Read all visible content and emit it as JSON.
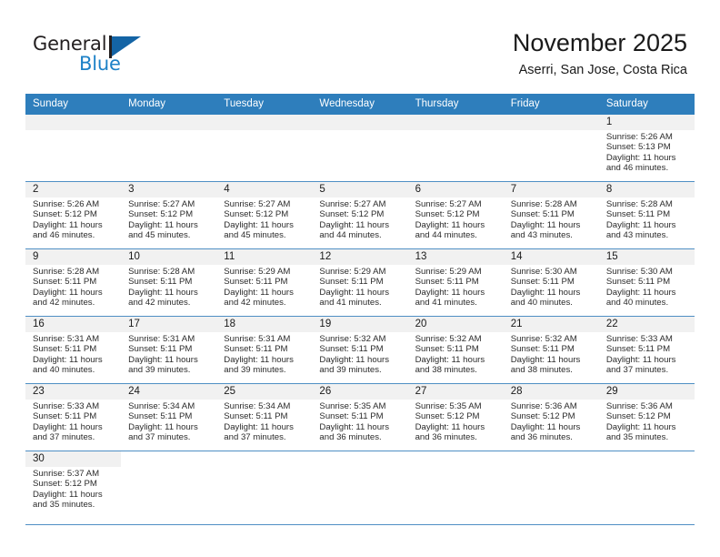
{
  "brand": {
    "name_top": "General",
    "name_bottom": "Blue",
    "accent_color": "#1d81c7",
    "flag_color": "#1464a5"
  },
  "header": {
    "title": "November 2025",
    "subtitle": "Aserri, San Jose, Costa Rica"
  },
  "theme": {
    "header_row_bg": "#2e7ebc",
    "row_divider": "#4f8fc4",
    "daynum_band_bg": "#f1f1f1",
    "text_color": "#2b2b2b"
  },
  "weekdays": [
    "Sunday",
    "Monday",
    "Tuesday",
    "Wednesday",
    "Thursday",
    "Friday",
    "Saturday"
  ],
  "labels": {
    "sunrise_prefix": "Sunrise:",
    "sunset_prefix": "Sunset:",
    "daylight_prefix": "Daylight:"
  },
  "weeks": [
    [
      {
        "day": "",
        "empty": true
      },
      {
        "day": "",
        "empty": true
      },
      {
        "day": "",
        "empty": true
      },
      {
        "day": "",
        "empty": true
      },
      {
        "day": "",
        "empty": true
      },
      {
        "day": "",
        "empty": true
      },
      {
        "day": "1",
        "sunrise": "Sunrise: 5:26 AM",
        "sunset": "Sunset: 5:13 PM",
        "daylight": "Daylight: 11 hours and 46 minutes."
      }
    ],
    [
      {
        "day": "2",
        "sunrise": "Sunrise: 5:26 AM",
        "sunset": "Sunset: 5:12 PM",
        "daylight": "Daylight: 11 hours and 46 minutes."
      },
      {
        "day": "3",
        "sunrise": "Sunrise: 5:27 AM",
        "sunset": "Sunset: 5:12 PM",
        "daylight": "Daylight: 11 hours and 45 minutes."
      },
      {
        "day": "4",
        "sunrise": "Sunrise: 5:27 AM",
        "sunset": "Sunset: 5:12 PM",
        "daylight": "Daylight: 11 hours and 45 minutes."
      },
      {
        "day": "5",
        "sunrise": "Sunrise: 5:27 AM",
        "sunset": "Sunset: 5:12 PM",
        "daylight": "Daylight: 11 hours and 44 minutes."
      },
      {
        "day": "6",
        "sunrise": "Sunrise: 5:27 AM",
        "sunset": "Sunset: 5:12 PM",
        "daylight": "Daylight: 11 hours and 44 minutes."
      },
      {
        "day": "7",
        "sunrise": "Sunrise: 5:28 AM",
        "sunset": "Sunset: 5:11 PM",
        "daylight": "Daylight: 11 hours and 43 minutes."
      },
      {
        "day": "8",
        "sunrise": "Sunrise: 5:28 AM",
        "sunset": "Sunset: 5:11 PM",
        "daylight": "Daylight: 11 hours and 43 minutes."
      }
    ],
    [
      {
        "day": "9",
        "sunrise": "Sunrise: 5:28 AM",
        "sunset": "Sunset: 5:11 PM",
        "daylight": "Daylight: 11 hours and 42 minutes."
      },
      {
        "day": "10",
        "sunrise": "Sunrise: 5:28 AM",
        "sunset": "Sunset: 5:11 PM",
        "daylight": "Daylight: 11 hours and 42 minutes."
      },
      {
        "day": "11",
        "sunrise": "Sunrise: 5:29 AM",
        "sunset": "Sunset: 5:11 PM",
        "daylight": "Daylight: 11 hours and 42 minutes."
      },
      {
        "day": "12",
        "sunrise": "Sunrise: 5:29 AM",
        "sunset": "Sunset: 5:11 PM",
        "daylight": "Daylight: 11 hours and 41 minutes."
      },
      {
        "day": "13",
        "sunrise": "Sunrise: 5:29 AM",
        "sunset": "Sunset: 5:11 PM",
        "daylight": "Daylight: 11 hours and 41 minutes."
      },
      {
        "day": "14",
        "sunrise": "Sunrise: 5:30 AM",
        "sunset": "Sunset: 5:11 PM",
        "daylight": "Daylight: 11 hours and 40 minutes."
      },
      {
        "day": "15",
        "sunrise": "Sunrise: 5:30 AM",
        "sunset": "Sunset: 5:11 PM",
        "daylight": "Daylight: 11 hours and 40 minutes."
      }
    ],
    [
      {
        "day": "16",
        "sunrise": "Sunrise: 5:31 AM",
        "sunset": "Sunset: 5:11 PM",
        "daylight": "Daylight: 11 hours and 40 minutes."
      },
      {
        "day": "17",
        "sunrise": "Sunrise: 5:31 AM",
        "sunset": "Sunset: 5:11 PM",
        "daylight": "Daylight: 11 hours and 39 minutes."
      },
      {
        "day": "18",
        "sunrise": "Sunrise: 5:31 AM",
        "sunset": "Sunset: 5:11 PM",
        "daylight": "Daylight: 11 hours and 39 minutes."
      },
      {
        "day": "19",
        "sunrise": "Sunrise: 5:32 AM",
        "sunset": "Sunset: 5:11 PM",
        "daylight": "Daylight: 11 hours and 39 minutes."
      },
      {
        "day": "20",
        "sunrise": "Sunrise: 5:32 AM",
        "sunset": "Sunset: 5:11 PM",
        "daylight": "Daylight: 11 hours and 38 minutes."
      },
      {
        "day": "21",
        "sunrise": "Sunrise: 5:32 AM",
        "sunset": "Sunset: 5:11 PM",
        "daylight": "Daylight: 11 hours and 38 minutes."
      },
      {
        "day": "22",
        "sunrise": "Sunrise: 5:33 AM",
        "sunset": "Sunset: 5:11 PM",
        "daylight": "Daylight: 11 hours and 37 minutes."
      }
    ],
    [
      {
        "day": "23",
        "sunrise": "Sunrise: 5:33 AM",
        "sunset": "Sunset: 5:11 PM",
        "daylight": "Daylight: 11 hours and 37 minutes."
      },
      {
        "day": "24",
        "sunrise": "Sunrise: 5:34 AM",
        "sunset": "Sunset: 5:11 PM",
        "daylight": "Daylight: 11 hours and 37 minutes."
      },
      {
        "day": "25",
        "sunrise": "Sunrise: 5:34 AM",
        "sunset": "Sunset: 5:11 PM",
        "daylight": "Daylight: 11 hours and 37 minutes."
      },
      {
        "day": "26",
        "sunrise": "Sunrise: 5:35 AM",
        "sunset": "Sunset: 5:11 PM",
        "daylight": "Daylight: 11 hours and 36 minutes."
      },
      {
        "day": "27",
        "sunrise": "Sunrise: 5:35 AM",
        "sunset": "Sunset: 5:12 PM",
        "daylight": "Daylight: 11 hours and 36 minutes."
      },
      {
        "day": "28",
        "sunrise": "Sunrise: 5:36 AM",
        "sunset": "Sunset: 5:12 PM",
        "daylight": "Daylight: 11 hours and 36 minutes."
      },
      {
        "day": "29",
        "sunrise": "Sunrise: 5:36 AM",
        "sunset": "Sunset: 5:12 PM",
        "daylight": "Daylight: 11 hours and 35 minutes."
      }
    ],
    [
      {
        "day": "30",
        "sunrise": "Sunrise: 5:37 AM",
        "sunset": "Sunset: 5:12 PM",
        "daylight": "Daylight: 11 hours and 35 minutes."
      },
      {
        "day": "",
        "empty": true,
        "blank": true
      },
      {
        "day": "",
        "empty": true,
        "blank": true
      },
      {
        "day": "",
        "empty": true,
        "blank": true
      },
      {
        "day": "",
        "empty": true,
        "blank": true
      },
      {
        "day": "",
        "empty": true,
        "blank": true
      },
      {
        "day": "",
        "empty": true,
        "blank": true
      }
    ]
  ]
}
